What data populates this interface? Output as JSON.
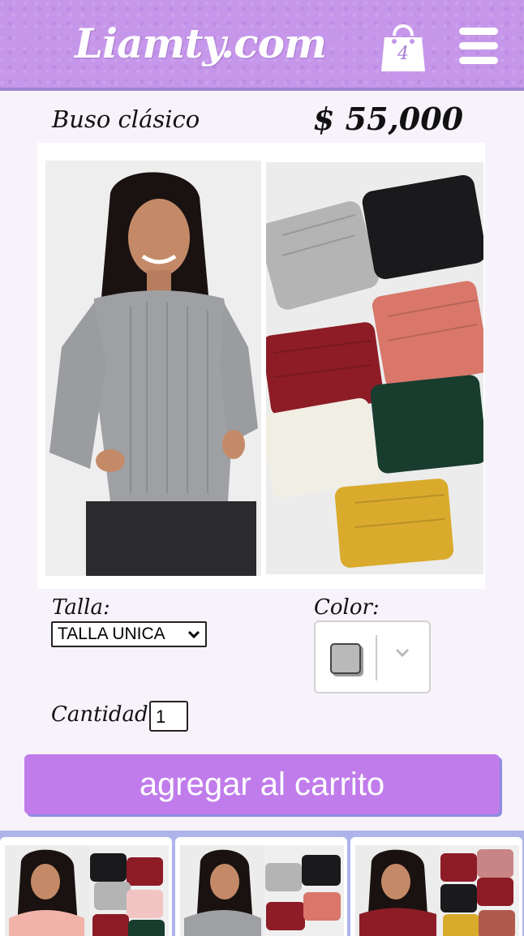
{
  "header": {
    "logo": "Liamty.com",
    "cart_count": "4",
    "colors": {
      "header_bg": "#c596ea",
      "accent": "#c07ceb"
    }
  },
  "product": {
    "name": "Buso clásico",
    "price": "$ 55,000",
    "image_alt": "Buso clásico en colores gris, negro, rosado, vino, blanco, verde y mostaza"
  },
  "options": {
    "size_label": "Talla:",
    "size_value": "TALLA UNICA",
    "color_label": "Color:",
    "color_value": "#b9b9b9",
    "quantity_label": "Cantidad:",
    "quantity_value": "1"
  },
  "actions": {
    "add_to_cart": "agregar al carrito"
  },
  "thumbnails": [
    {
      "name": "pink-sweater-thumbnail"
    },
    {
      "name": "gray-sweater-thumbnail"
    },
    {
      "name": "red-sweater-thumbnail"
    }
  ],
  "icons": [
    "shopping-bag-icon",
    "hamburger-menu-icon",
    "chevron-down-icon"
  ]
}
